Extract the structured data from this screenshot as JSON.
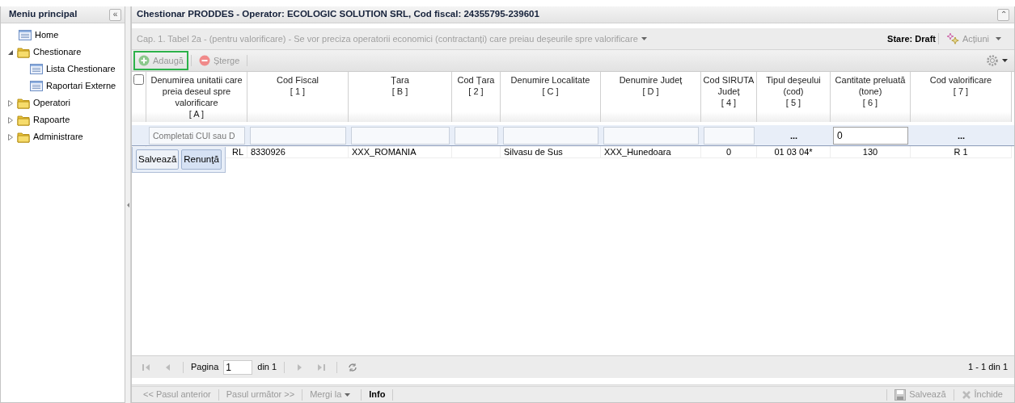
{
  "sidebar": {
    "title": "Meniu principal",
    "collapse_button": "«",
    "items": [
      {
        "label": "Home",
        "kind": "page"
      },
      {
        "label": "Chestionare",
        "kind": "folder",
        "expanded": true,
        "children": [
          {
            "label": "Lista Chestionare",
            "kind": "page"
          },
          {
            "label": "Raportari Externe",
            "kind": "page"
          }
        ]
      },
      {
        "label": "Operatori",
        "kind": "folder",
        "expanded": false
      },
      {
        "label": "Rapoarte",
        "kind": "folder",
        "expanded": false
      },
      {
        "label": "Administrare",
        "kind": "folder",
        "expanded": false
      }
    ]
  },
  "window": {
    "title": "Chestionar PRODDES - Operator: ECOLOGIC SOLUTION SRL, Cod fiscal: 24355795-239601",
    "collapse_button": "⌃"
  },
  "section": {
    "label": "Cap. 1. Tabel 2a - (pentru valorificare) - Se vor preciza operatorii economici (contractanți) care preiau deșeurile spre valorificare",
    "status": "Stare: Draft",
    "actions": "Acțiuni"
  },
  "toolbar": [
    {
      "label": "Adaugă",
      "kind": "add",
      "disabled": true,
      "highlighted": true
    },
    {
      "label": "Șterge",
      "kind": "delete",
      "disabled": true,
      "highlighted": false
    }
  ],
  "table": {
    "select_all": {
      "checked": false
    },
    "columns": [
      {
        "label": "Denumirea unitatii care preia deseul spre valorificare",
        "index": "[ A ]"
      },
      {
        "label": "Cod Fiscal",
        "index": "[ 1 ]"
      },
      {
        "label": "Țara",
        "index": "[ B ]"
      },
      {
        "label": "Cod Țara",
        "index": "[ 2 ]"
      },
      {
        "label": "Denumire Localitate",
        "index": "[ C ]"
      },
      {
        "label": "Denumire Județ",
        "index": "[ D ]"
      },
      {
        "label": "Cod SIRUTA Județ",
        "index": "[ 4 ]"
      },
      {
        "label": "Tipul deșeului (cod)",
        "index": "[ 5 ]"
      },
      {
        "label": "Cantitate preluată (tone)",
        "index": "[ 6 ]"
      },
      {
        "label": "Cod valorificare",
        "index": "[ 7 ]"
      }
    ],
    "editor": [
      {
        "kind": "input",
        "placeholder": "Completati CUI sau D"
      },
      {
        "kind": "input"
      },
      {
        "kind": "input"
      },
      {
        "kind": "input"
      },
      {
        "kind": "input"
      },
      {
        "kind": "input"
      },
      {
        "kind": "input"
      },
      {
        "kind": "picker",
        "text": "..."
      },
      {
        "kind": "input",
        "value": "0"
      },
      {
        "kind": "picker",
        "text": "..."
      }
    ],
    "editor_buttons": [
      "Salvează",
      "Renunţă"
    ],
    "rows": [
      {
        "cells": [
          "RL",
          "8330926",
          "XXX_ROMANIA",
          "",
          "Silvasu de Sus",
          "XXX_Hunedoara",
          "0",
          "01 03 04*",
          "130",
          "R 1"
        ]
      }
    ]
  },
  "pager": {
    "page_label": "Pagina",
    "page": "1",
    "of": "din 1",
    "summary": "1 - 1 din 1"
  },
  "footer": {
    "left": [
      {
        "label": "<< Pasul anterior",
        "kind": "link",
        "disabled": true
      },
      {
        "label": "Pasul următor >>",
        "kind": "link",
        "disabled": true
      },
      {
        "label": "Mergi la",
        "kind": "menu",
        "disabled": true
      },
      {
        "label": "Info",
        "kind": "link",
        "disabled": false
      }
    ],
    "right": [
      {
        "label": "Salvează",
        "kind": "save",
        "disabled": true
      },
      {
        "label": "Închide",
        "kind": "close",
        "disabled": true
      }
    ]
  }
}
